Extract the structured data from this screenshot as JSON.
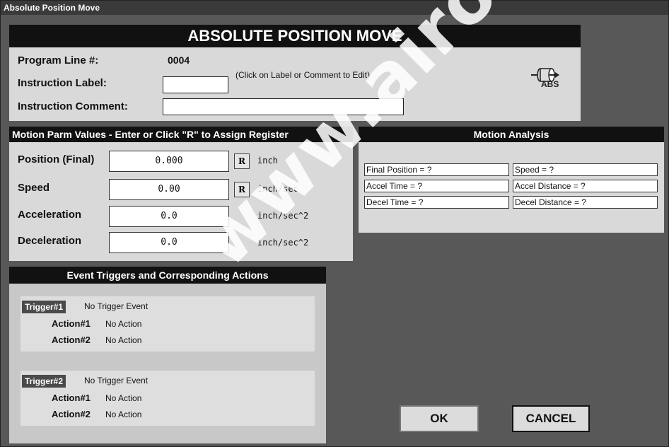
{
  "window": {
    "title": "Absolute Position Move"
  },
  "header": {
    "title": "ABSOLUTE POSITION MOVE",
    "program_line_label": "Program Line #:",
    "program_line_value": "0004",
    "instruction_label_label": "Instruction Label:",
    "instruction_label_value": "",
    "hint": "(Click on Label or Comment to Edit)",
    "instruction_comment_label": "Instruction Comment:",
    "instruction_comment_value": "",
    "icon_text": "ABS"
  },
  "motion_parms": {
    "title": "Motion Parm Values - Enter or Click \"R\"  to Assign Register",
    "register_button_label": "R",
    "rows": [
      {
        "label": "Position (Final)",
        "value": "0.000",
        "unit": "inch",
        "has_register": true
      },
      {
        "label": "Speed",
        "value": "0.00",
        "unit": "inch/sec",
        "has_register": true
      },
      {
        "label": "Acceleration",
        "value": "0.0",
        "unit": "inch/sec^2",
        "has_register": false
      },
      {
        "label": "Deceleration",
        "value": "0.0",
        "unit": "inch/sec^2",
        "has_register": false
      }
    ]
  },
  "analysis": {
    "title": "Motion Analysis",
    "final_position": "Final Position = ?",
    "speed": "Speed = ?",
    "accel_time": "Accel Time = ?",
    "accel_distance": "Accel Distance = ?",
    "decel_time": "Decel Time = ?",
    "decel_distance": "Decel Distance = ?"
  },
  "events": {
    "title": "Event Triggers and Corresponding Actions",
    "triggers": [
      {
        "tag": "Trigger#1",
        "event": "No Trigger Event",
        "action1_label": "Action#1",
        "action1": "No Action",
        "action2_label": "Action#2",
        "action2": "No Action"
      },
      {
        "tag": "Trigger#2",
        "event": "No Trigger Event",
        "action1_label": "Action#1",
        "action1": "No Action",
        "action2_label": "Action#2",
        "action2": "No Action"
      }
    ]
  },
  "buttons": {
    "ok": "OK",
    "cancel": "CANCEL"
  },
  "watermark": "www.airoil.com",
  "colors": {
    "background": "#585858",
    "panel": "#d9d9d9",
    "header_bar": "#111111"
  }
}
